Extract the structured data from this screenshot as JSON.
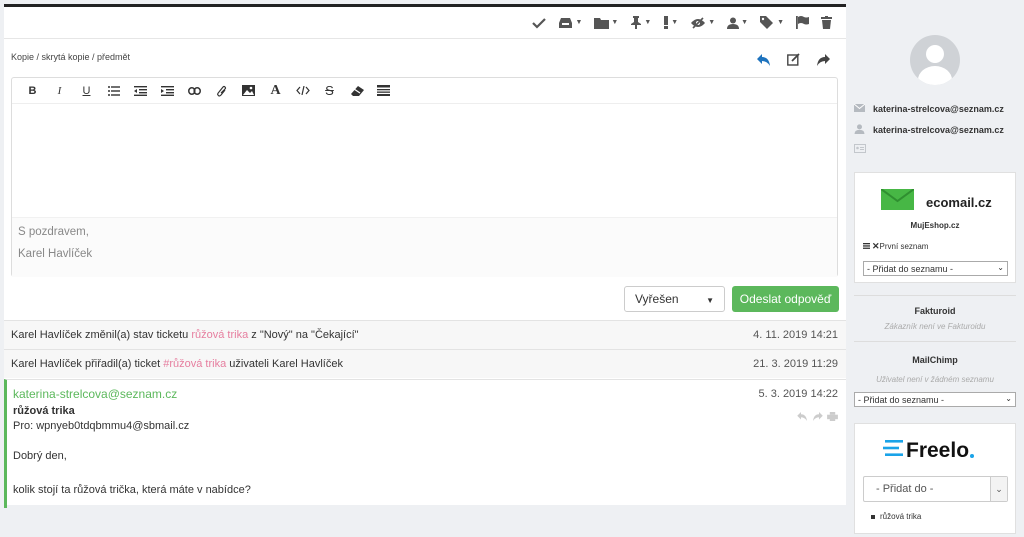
{
  "toolbar": {
    "icons": [
      "check-icon",
      "inbox-icon",
      "folder-icon",
      "pin-icon",
      "priority-icon",
      "visibility-icon",
      "user-icon",
      "tags-icon",
      "flag-icon",
      "trash-icon"
    ]
  },
  "compose": {
    "links": "Kopie / skrytá kopie / předmět",
    "signature_line1": "S pozdravem,",
    "signature_line2": "Karel Havlíček",
    "status_value": "Vyřešen",
    "send_label": "Odeslat odpověď"
  },
  "history": [
    {
      "pre": "Karel Havlíček změnil(a) stav ticketu ",
      "ticket": "růžová trika",
      "post": " z \"Nový\" na \"Čekající\"",
      "date": "4. 11. 2019 14:21"
    },
    {
      "pre": "Karel Havlíček přiřadil(a) ticket ",
      "ticket": "#růžová trika",
      "post": " uživateli Karel Havlíček",
      "date": "21. 3. 2019 11:29"
    }
  ],
  "message": {
    "from": "katerina-strelcova@seznam.cz",
    "date": "5. 3. 2019 14:22",
    "subject": "růžová trika",
    "to": "Pro: wpnyeb0tdqbmmu4@sbmail.cz",
    "body1": "Dobrý den,",
    "body2": "kolik stojí ta růžová trička, která máte v nabídce?"
  },
  "sidebar": {
    "email": "katerina-strelcova@seznam.cz",
    "name": "katerina-strelcova@seznam.cz",
    "ecomail": {
      "logo_text": "ecomail.cz",
      "shop": "MujEshop.cz",
      "list": "První seznam",
      "select": "- Přidat do seznamu -"
    },
    "fakturoid": {
      "title": "Fakturoid",
      "status": "Zákazník není ve Fakturoidu"
    },
    "mailchimp": {
      "title": "MailChimp",
      "status": "Uživatel není v žádném seznamu",
      "select": "- Přidat do seznamu -"
    },
    "freelo": {
      "logo_text": "Freelo",
      "select": "- Přidat do -",
      "item": "růžová trika"
    }
  },
  "colors": {
    "accent_green": "#5cb85c",
    "link_pink": "#e67e9f",
    "blue_icon": "#1e73be",
    "freelo_blue": "#1aa3e8"
  }
}
